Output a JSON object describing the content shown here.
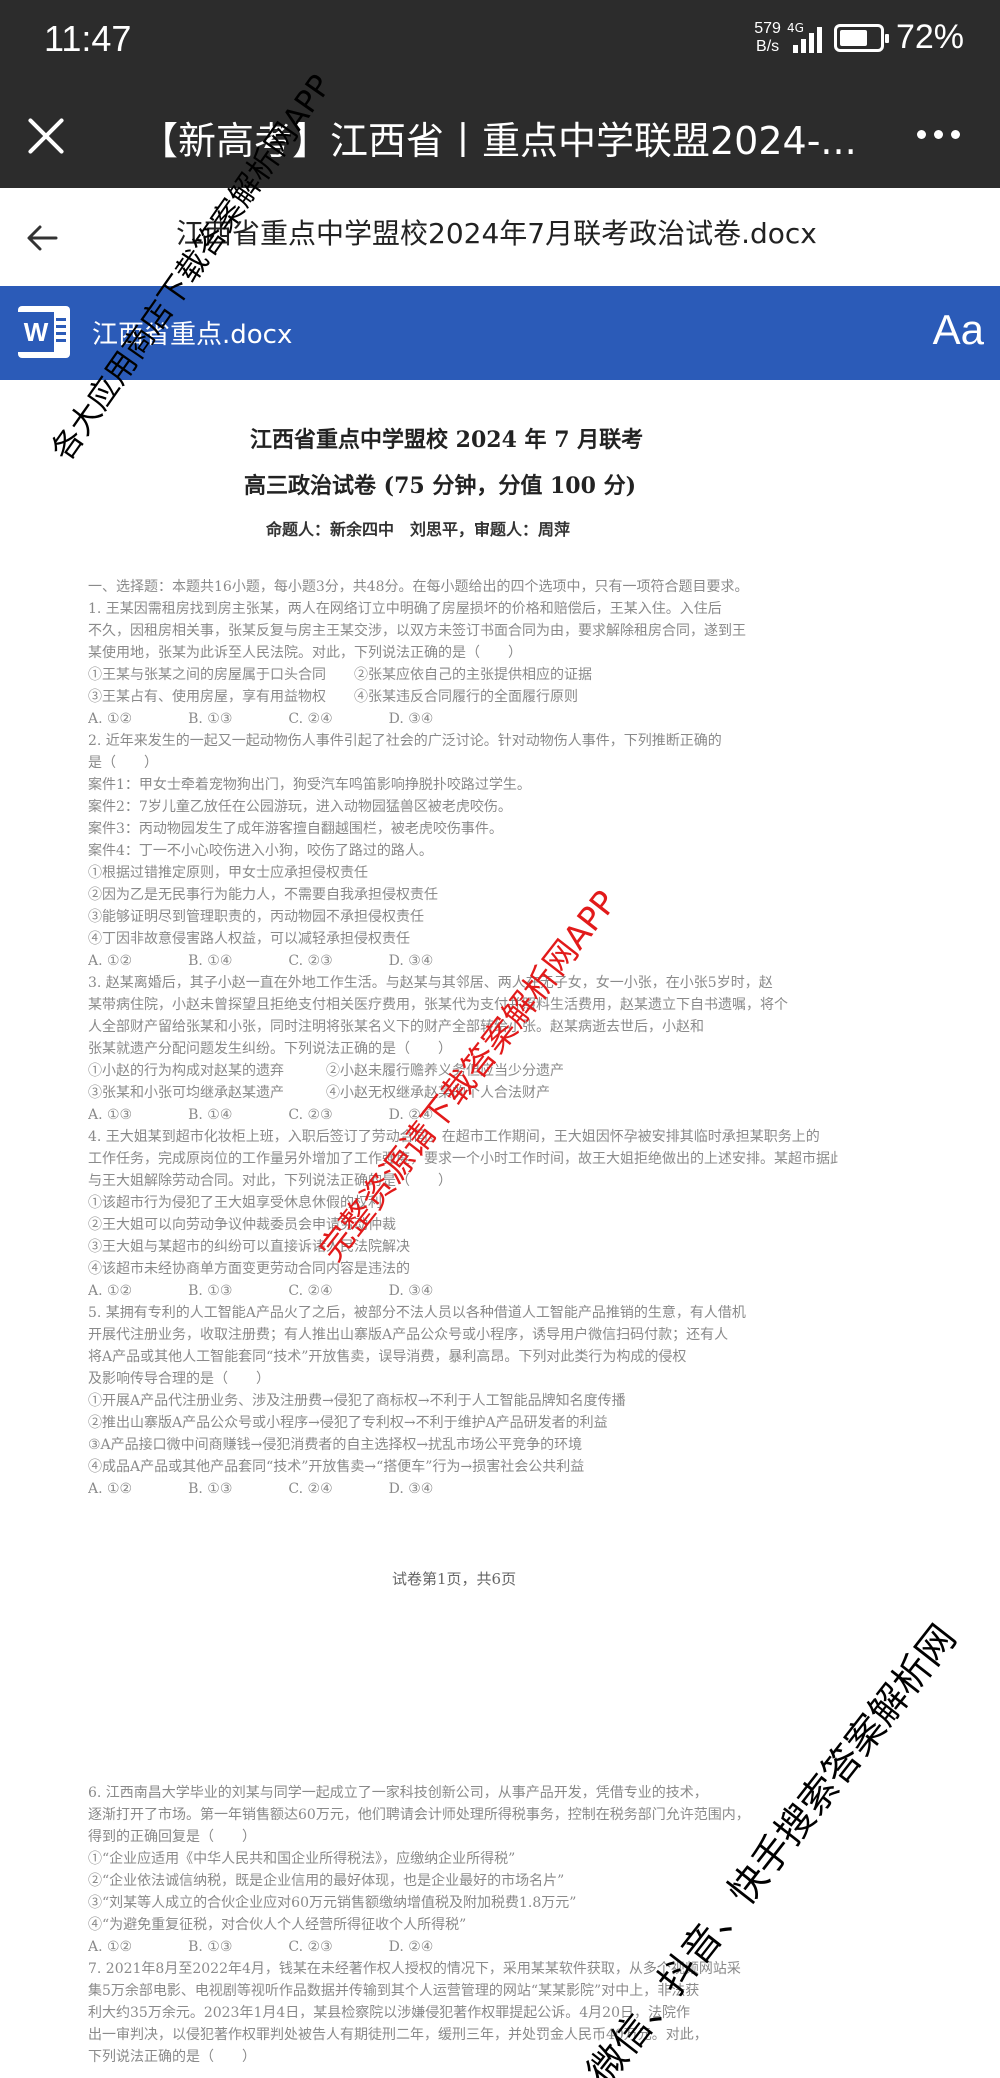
{
  "status_bar": {
    "time": "11:47",
    "net_speed_value": "579",
    "net_speed_unit": "B/s",
    "network_type": "4G",
    "battery_percent": "72%",
    "battery_level": 0.72
  },
  "app_header": {
    "title": "【新高考】江西省丨重点中学联盟2024-..."
  },
  "doc_header": {
    "filename": "江西省重点中学盟校2024年7月联考政治试卷.docx"
  },
  "word_bar": {
    "icon_letter": "W",
    "doc_name": "江西省重点.docx",
    "font_button": "Aa"
  },
  "document": {
    "title": "江西省重点中学盟校 2024 年 7 月联考",
    "subtitle": "高三政治试卷 (75 分钟，分值 100 分)",
    "authors": "命题人：新余四中　刘思平，审题人：周萍",
    "lines_block1": [
      "一、选择题：本题共16小题，每小题3分，共48分。在每小题给出的四个选项中，只有一项符合题目要求。",
      "1. 王某因需租房找到房主张某，两人在网络订立中明确了房屋损坏的价格和赔偿后，王某入住。入住后",
      "不久，因租房相关事，张某反复与房主王某交涉，以双方未签订书面合同为由，要求解除租房合同，遂到王",
      "某使用地，张某为此诉至人民法院。对此，下列说法正确的是（　　）",
      "①王某与张某之间的房屋属于口头合同　　②张某应依自己的主张提供相应的证据",
      "③王某占有、使用房屋，享有用益物权　　④张某违反合同履行的全面履行原则",
      "A. ①②　　　　B. ①③　　　　C. ②④　　　　D. ③④",
      "2. 近年来发生的一起又一起动物伤人事件引起了社会的广泛讨论。针对动物伤人事件，下列推断正确的",
      "是（　　）",
      "案件1：甲女士牵着宠物狗出门，狗受汽车鸣笛影响挣脱扑咬路过学生。",
      "案件2：7岁儿童乙放任在公园游玩，进入动物园猛兽区被老虎咬伤。",
      "案件3：丙动物园发生了成年游客擅自翻越围栏，被老虎咬伤事件。",
      "案件4：丁一不小心咬伤进入小狗，咬伤了路过的路人。",
      "①根据过错推定原则，甲女士应承担侵权责任",
      "②因为乙是无民事行为能力人，不需要自我承担侵权责任",
      "③能够证明尽到管理职责的，丙动物园不承担侵权责任",
      "④丁因非故意侵害路人权益，可以减轻承担侵权责任",
      "A. ①②　　　　B. ①④　　　　C. ②③　　　　D. ③④",
      "3. 赵某离婚后，其子小赵一直在外地工作生活。与赵某与其邻居、两人在无子女，女一小张，在小张5岁时，赵",
      "某带病住院，小赵未曾探望且拒绝支付相关医疗费用，张某代为支付并照料生活费用，赵某遗立下自书遗嘱，将个",
      "人全部财产留给张某和小张，同时注明将张某名义下的财产全部转给小张。赵某病逝去世后，小赵和",
      "张某就遗产分配问题发生纠纷。下列说法正确的是（　　）",
      "①小赵的行为构成对赵某的遗弃　　　②小赵未履行赡养义务但应当少分遗产",
      "③张某和小张可均继承赵某遗产　　　④小赵无权继承赵某的个人合法财产",
      "A. ①③　　　　B. ①④　　　　C. ②③　　　　D. ②④",
      "4. 王大姐某到超市化妆柜上班，入职后签订了劳动合同。在超市工作期间，王大姐因怀孕被安排其临时承担某职务上的",
      "工作任务，完成原岗位的工作量另外增加了工作强度，要求一个小时工作时间，故王大姐拒绝做出的上述安排。某超市据此",
      "与王大姐解除劳动合同。对此，下列说法正确的是（　　）",
      "①该超市行为侵犯了王大姐享受休息休假的权利",
      "②王大姐可以向劳动争议仲裁委员会申请劳动仲裁",
      "③王大姐与某超市的纠纷可以直接诉诸人民法院解决",
      "④该超市未经协商单方面变更劳动合同内容是违法的",
      "A. ①②　　　　B. ①③　　　　C. ②④　　　　D. ③④",
      "5. 某拥有专利的人工智能A产品火了之后，被部分不法人员以各种借道人工智能产品推销的生意，有人借机",
      "开展代注册业务，收取注册费；有人推出山寨版A产品公众号或小程序，诱导用户微信扫码付款；还有人",
      "将A产品或其他人工智能套同“技术”开放售卖，误导消费，暴利高昂。下列对此类行为构成的侵权",
      "及影响传导合理的是（　　）",
      "①开展A产品代注册业务、涉及注册费→侵犯了商标权→不利于人工智能品牌知名度传播",
      "②推出山寨版A产品公众号或小程序→侵犯了专利权→不利于维护A产品研发者的利益",
      "③A产品接口微中间商赚钱→侵犯消费者的自主选择权→扰乱市场公平竞争的环境",
      "④成品A产品或其他产品套同“技术”开放售卖→“搭便车”行为→损害社会公共利益",
      "A. ①②　　　　B. ①③　　　　C. ②④　　　　D. ③④"
    ],
    "page_footer": "试卷第1页，共6页",
    "lines_block2": [
      "6. 江西南昌大学毕业的刘某与同学一起成立了一家科技创新公司，从事产品开发，凭借专业的技术，",
      "逐渐打开了市场。第一年销售额达60万元，他们聘请会计师处理所得税事务，控制在税务部门允许范围内，",
      "得到的正确回复是（　　）",
      "①“企业应适用《中华人民共和国企业所得税法》，应缴纳企业所得税”",
      "②“企业依法诚信纳税，既是企业信用的最好体现，也是企业最好的市场名片”",
      "③“刘某等人成立的合伙企业应对60万元销售额缴纳增值税及附加税费1.8万元”",
      "④“为避免重复征税，对合伙人个人经营所得征收个人所得税”",
      "A. ①②　　　　B. ①③　　　　C. ②③　　　　D. ②④",
      "7. 2021年8月至2022年4月，钱某在未经著作权人授权的情况下，采用某某软件获取，从多个视频网站采",
      "集5万余部电影、电视剧等视听作品数据并传输到其个人运营管理的网站“某某影院”对中上，非法获",
      "利大约35万余元。2023年1月4日，某县检察院以涉嫌侵犯著作权罪提起公诉。4月20日，法院作",
      "出一审判决，以侵犯著作权罪判处被告人有期徒刑二年，缓刑三年，并处罚金人民币40万元。对此，",
      "下列说法正确的是（　　）"
    ]
  },
  "watermarks": {
    "top": "各大应用商店下载答案解析网APP",
    "center": "完整资源请下载答案解析网APP",
    "bottom": "微信、抖音、快手搜索答案解析网"
  }
}
